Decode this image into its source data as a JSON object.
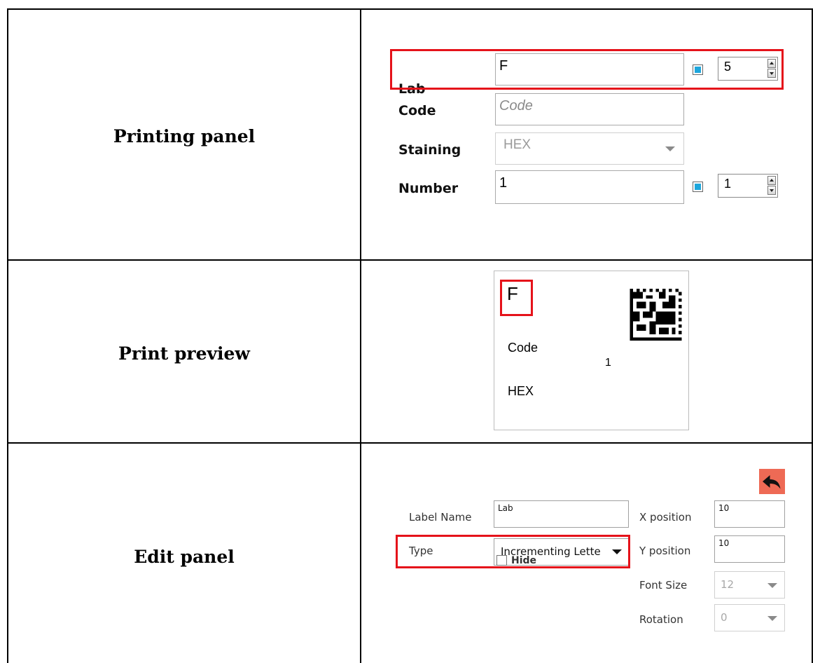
{
  "rows": [
    {
      "label": "Printing panel"
    },
    {
      "label": "Print preview"
    },
    {
      "label": "Edit panel"
    }
  ],
  "printing_panel": {
    "lab_label": "Lab",
    "lab_value": "F",
    "lab_checked": true,
    "lab_spin_value": "5",
    "code_label": "Code",
    "code_placeholder": "Code",
    "staining_label": "Staining",
    "staining_value": "HEX",
    "number_label": "Number",
    "number_value": "1",
    "number_checked": true,
    "number_spin_value": "1"
  },
  "preview": {
    "lab_text": "F",
    "code_text": "Code",
    "number_text": "1",
    "staining_text": "HEX",
    "barcode_icon": "datamatrix-barcode-icon"
  },
  "edit_panel": {
    "undo_icon": "undo-arrow-icon",
    "label_name_label": "Label Name",
    "label_name_value": "Lab",
    "type_label": "Type",
    "type_value": "Incrementing Lette",
    "x_position_label": "X position",
    "x_position_value": "10",
    "y_position_label": "Y position",
    "y_position_value": "10",
    "font_size_label": "Font Size",
    "font_size_value": "12",
    "rotation_label": "Rotation",
    "rotation_value": "0",
    "hide_label": "Hide",
    "hide_checked": false
  },
  "colors": {
    "highlight": "#e5121a",
    "checkbox_fill": "#1ea6dc",
    "undo_button": "#ee6a55"
  }
}
